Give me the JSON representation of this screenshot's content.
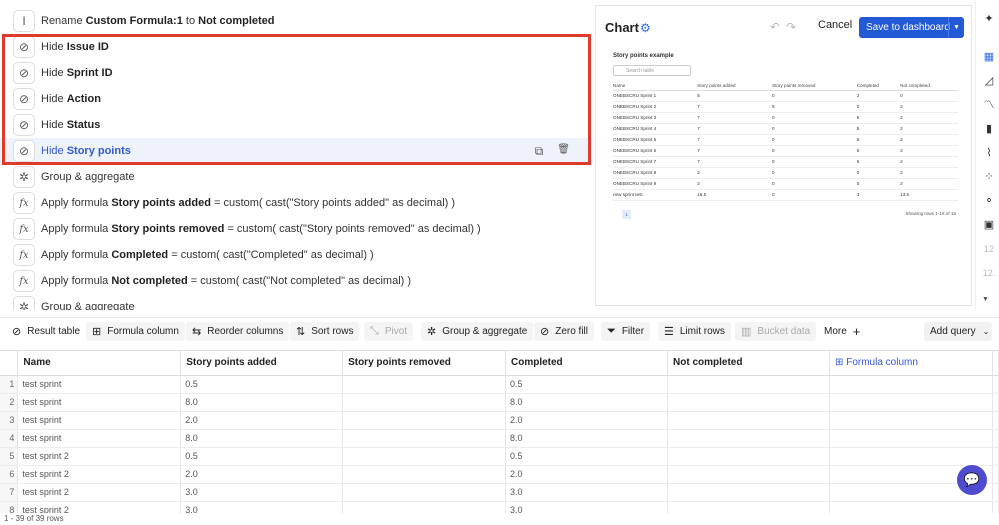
{
  "steps": [
    {
      "prefix": "Rename ",
      "bold": "Custom Formula:1",
      "suffix": " to ",
      "bold2": "Not completed",
      "icon": "text-cursor-icon",
      "glyph": "I"
    },
    {
      "prefix": "Hide ",
      "bold": "Issue ID",
      "icon": "eye-off-icon",
      "glyph": "⊘"
    },
    {
      "prefix": "Hide ",
      "bold": "Sprint ID",
      "icon": "eye-off-icon",
      "glyph": "⊘"
    },
    {
      "prefix": "Hide ",
      "bold": "Action",
      "icon": "eye-off-icon",
      "glyph": "⊘"
    },
    {
      "prefix": "Hide ",
      "bold": "Status",
      "icon": "eye-off-icon",
      "glyph": "⊘"
    },
    {
      "prefix": "Hide ",
      "bold": "Story points",
      "icon": "eye-off-icon",
      "glyph": "⊘",
      "selected": true
    },
    {
      "prefix": "Group & aggregate",
      "bold": "",
      "icon": "aggregate-icon",
      "glyph": "✲"
    },
    {
      "prefix": "Apply formula ",
      "bold": "Story points added",
      "suffix": " = custom( cast(\"Story points added\" as decimal) )",
      "icon": "formula-icon",
      "glyph": "fx"
    },
    {
      "prefix": "Apply formula ",
      "bold": "Story points removed",
      "suffix": " = custom( cast(\"Story points removed\" as decimal) )",
      "icon": "formula-icon",
      "glyph": "fx"
    },
    {
      "prefix": "Apply formula ",
      "bold": "Completed",
      "suffix": " = custom( cast(\"Completed\" as decimal) )",
      "icon": "formula-icon",
      "glyph": "fx"
    },
    {
      "prefix": "Apply formula ",
      "bold": "Not completed",
      "suffix": " = custom( cast(\"Not completed\" as decimal) )",
      "icon": "formula-icon",
      "glyph": "fx"
    },
    {
      "prefix": "Group & aggregate",
      "bold": "",
      "icon": "aggregate-icon",
      "glyph": "✲"
    }
  ],
  "chart_panel": {
    "title": "Chart",
    "cancel": "Cancel",
    "save": "Save to dashboard",
    "preview_title": "Story points example",
    "search_placeholder": "Search table",
    "columns": [
      "Name",
      "Story points added",
      "Story points removed",
      "Completed",
      "Not completed"
    ],
    "rows": [
      [
        "ONEBSCRU Sprint 1",
        "5",
        "0",
        "2",
        "0"
      ],
      [
        "ONEBSCRU Sprint 2",
        "7",
        "5",
        "0",
        "2"
      ],
      [
        "ONEBSCRU Sprint 3",
        "7",
        "0",
        "5",
        "2"
      ],
      [
        "ONEBSCRU Sprint 4",
        "7",
        "0",
        "5",
        "2"
      ],
      [
        "ONEBSCRU Sprint 5",
        "7",
        "0",
        "5",
        "2"
      ],
      [
        "ONEBSCRU Sprint 6",
        "7",
        "0",
        "5",
        "2"
      ],
      [
        "ONEBSCRU Sprint 7",
        "7",
        "0",
        "5",
        "2"
      ],
      [
        "ONEBSCRU Sprint 8",
        "2",
        "0",
        "0",
        "2"
      ],
      [
        "ONEBSCRU Sprint 9",
        "2",
        "0",
        "0",
        "2"
      ],
      [
        "new sprint test",
        "16.5",
        "0",
        "3",
        "13.5"
      ]
    ],
    "page": "1",
    "rows_label": "Showing rows 1-16 of 16"
  },
  "side_tools": [
    "magic-icon",
    "table-icon",
    "area-chart-icon",
    "line-chart-icon",
    "bar-chart-icon",
    "trend-icon",
    "scatter-icon",
    "bubble-icon",
    "number-icon",
    "12",
    "12."
  ],
  "toolbar": {
    "result_table": "Result table",
    "formula_column": "Formula column",
    "reorder_columns": "Reorder columns",
    "sort_rows": "Sort rows",
    "pivot": "Pivot",
    "group_aggregate": "Group & aggregate",
    "zero_fill": "Zero fill",
    "filter": "Filter",
    "limit_rows": "Limit rows",
    "bucket_data": "Bucket data",
    "more": "More",
    "add_query": "Add query"
  },
  "grid": {
    "columns": [
      "Name",
      "Story points added",
      "Story points removed",
      "Completed",
      "Not completed",
      "Formula column"
    ],
    "rows": [
      {
        "n": "1",
        "name": "test sprint",
        "added": "0.5",
        "completed": "0.5"
      },
      {
        "n": "2",
        "name": "test sprint",
        "added": "8.0",
        "completed": "8.0"
      },
      {
        "n": "3",
        "name": "test sprint",
        "added": "2.0",
        "completed": "2.0"
      },
      {
        "n": "4",
        "name": "test sprint",
        "added": "8.0",
        "completed": "8.0"
      },
      {
        "n": "5",
        "name": "test sprint 2",
        "added": "0.5",
        "completed": "0.5"
      },
      {
        "n": "6",
        "name": "test sprint 2",
        "added": "2.0",
        "completed": "2.0"
      },
      {
        "n": "7",
        "name": "test sprint 2",
        "added": "3.0",
        "completed": "3.0"
      },
      {
        "n": "8",
        "name": "test sprint 2",
        "added": "3.0",
        "completed": "3.0"
      }
    ]
  },
  "status": "1 - 39 of 39 rows"
}
